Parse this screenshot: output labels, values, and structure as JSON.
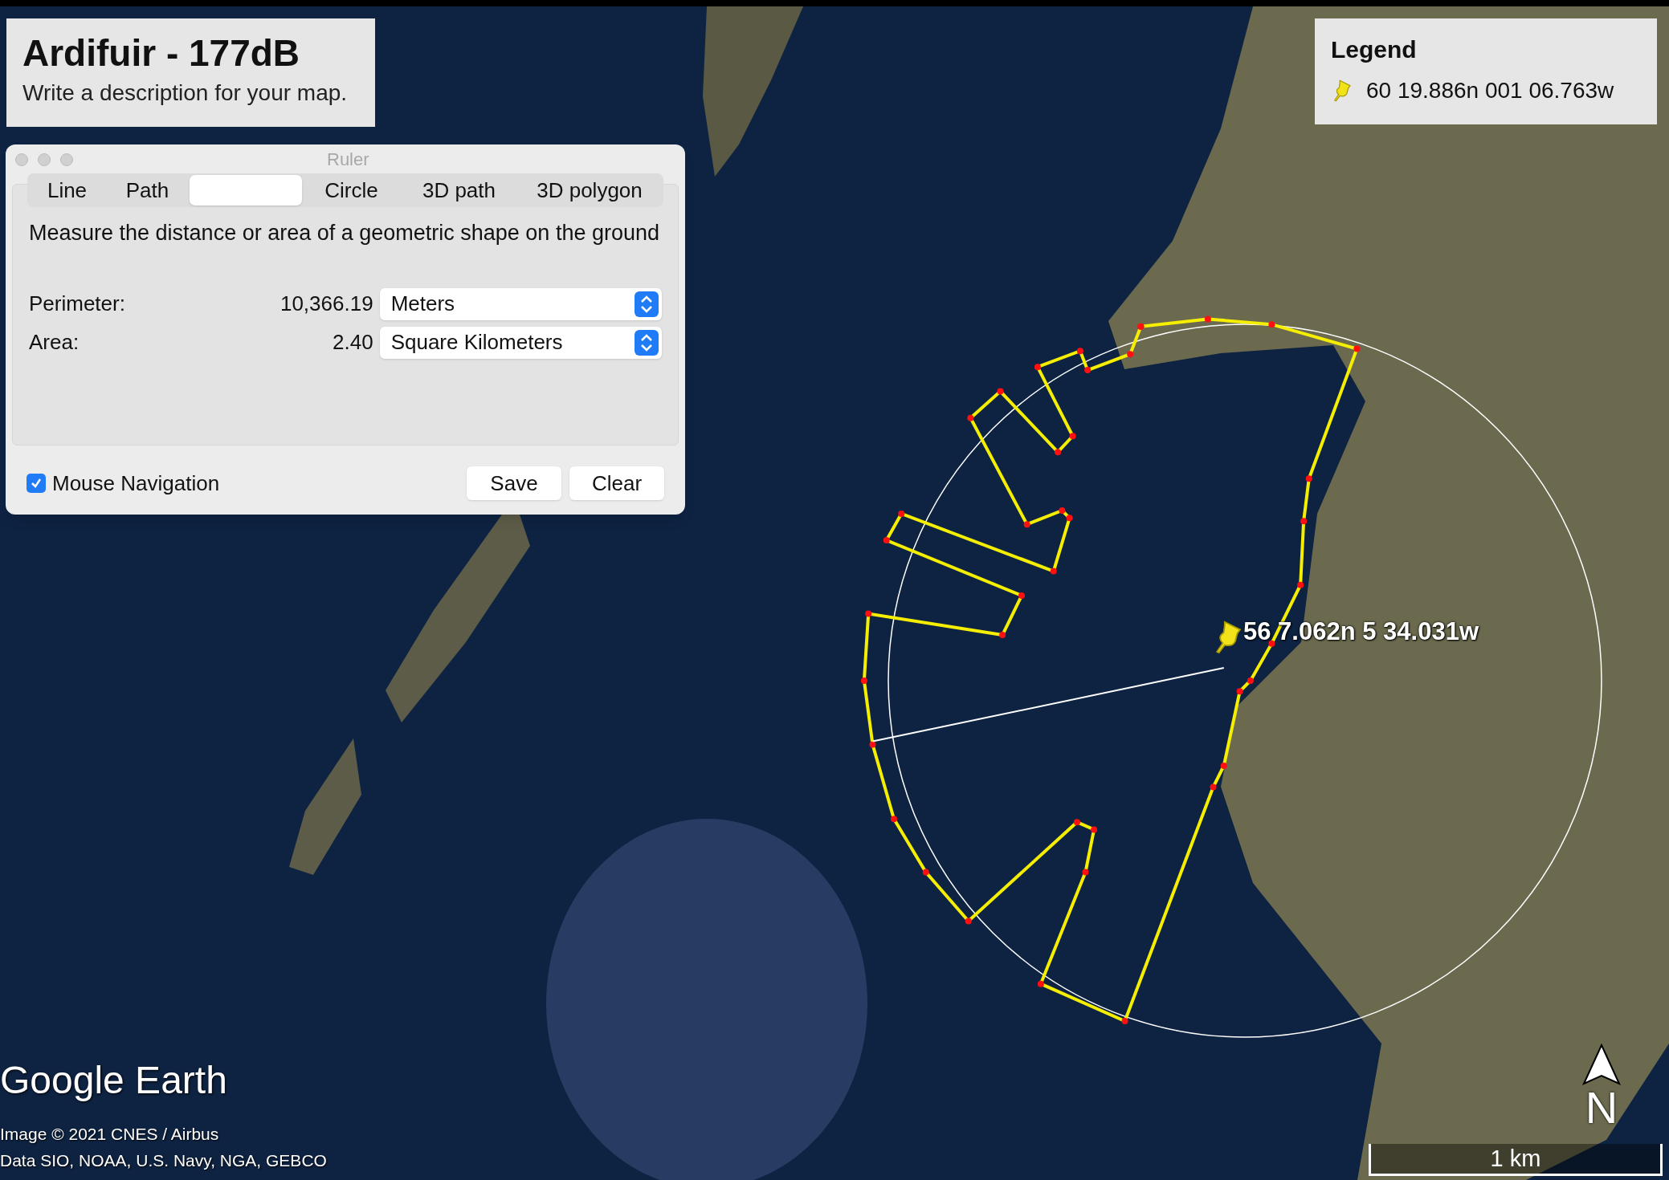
{
  "title_card": {
    "title": "Ardifuir - 177dB",
    "description": "Write a description for your map."
  },
  "ruler": {
    "title": "Ruler",
    "tabs": [
      {
        "label": "Line",
        "selected": false
      },
      {
        "label": "Path",
        "selected": false
      },
      {
        "selected": true
      },
      {
        "label": "Circle",
        "selected": false
      },
      {
        "label": "3D path",
        "selected": false
      },
      {
        "label": "3D polygon",
        "selected": false
      }
    ],
    "instruction": "Measure the distance or area of a geometric shape on the ground",
    "measurements": [
      {
        "label": "Perimeter:",
        "value": "10,366.19",
        "unit": "Meters"
      },
      {
        "label": "Area:",
        "value": "2.40",
        "unit": "Square Kilometers"
      }
    ],
    "mouse_navigation": {
      "label": "Mouse Navigation",
      "checked": true
    },
    "buttons": [
      "Save",
      "Clear"
    ]
  },
  "legend": {
    "title": "Legend",
    "entries": [
      {
        "label": "60 19.886n 001 06.763w"
      }
    ]
  },
  "map": {
    "placemark_label": "56 7.062n 5 34.031w",
    "logo": "Google Earth",
    "attributions": [
      "Image © 2021 CNES / Airbus",
      "Data SIO, NOAA, U.S. Navy, NGA, GEBCO"
    ],
    "compass_letter": "N",
    "scale": "1 km"
  }
}
